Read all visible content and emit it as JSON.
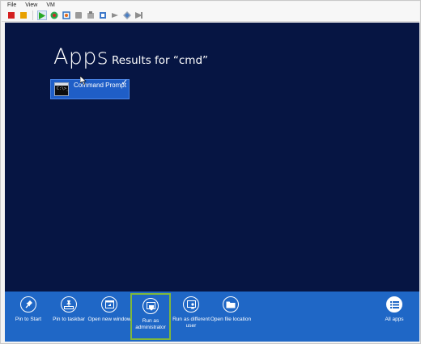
{
  "menu": [
    "File",
    "View",
    "VM"
  ],
  "screen": {
    "heading": "Apps",
    "results": "Results for “cmd”",
    "tile": {
      "label": "Command Prompt",
      "icon_text": "C:\\>_",
      "selected": true
    }
  },
  "appbar": {
    "buttons": [
      {
        "label": "Pin to Start",
        "icon": "pin-icon"
      },
      {
        "label": "Pin to taskbar",
        "icon": "pin-taskbar-icon"
      },
      {
        "label": "Open new window",
        "icon": "new-window-icon"
      },
      {
        "label": "Run as administrator",
        "icon": "shield-icon",
        "highlighted": true
      },
      {
        "label": "Run as different user",
        "icon": "different-user-icon"
      },
      {
        "label": "Open file location",
        "icon": "folder-icon"
      }
    ],
    "all_apps": {
      "label": "All apps",
      "icon": "list-icon"
    }
  },
  "colors": {
    "screen_bg": "#061543",
    "appbar_bg": "#1f67c6",
    "tile_bg": "#1f5ec7",
    "highlight": "#7fb83a"
  }
}
